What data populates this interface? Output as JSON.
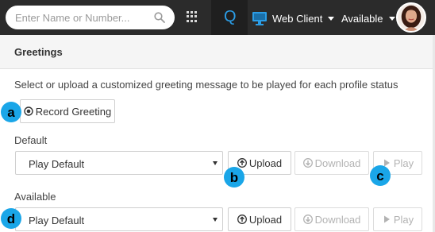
{
  "topbar": {
    "search_placeholder": "Enter Name or Number...",
    "q_label": "Q",
    "web_client_label": "Web Client",
    "status_label": "Available"
  },
  "section": {
    "title": "Greetings",
    "description": "Select or upload a customized greeting message to be played for each profile status"
  },
  "record_button": {
    "label": "Record Greeting"
  },
  "statuses": [
    {
      "label": "Default",
      "selected": "Play Default",
      "upload_label": "Upload",
      "download_label": "Download",
      "play_label": "Play"
    },
    {
      "label": "Available",
      "selected": "Play Default",
      "upload_label": "Upload",
      "download_label": "Download",
      "play_label": "Play"
    }
  ],
  "callouts": {
    "a": "a",
    "b": "b",
    "c": "c",
    "d": "d"
  },
  "colors": {
    "topbar": "#2b2b2b",
    "accent": "#2b9de6",
    "callout": "#1aa6e8"
  }
}
